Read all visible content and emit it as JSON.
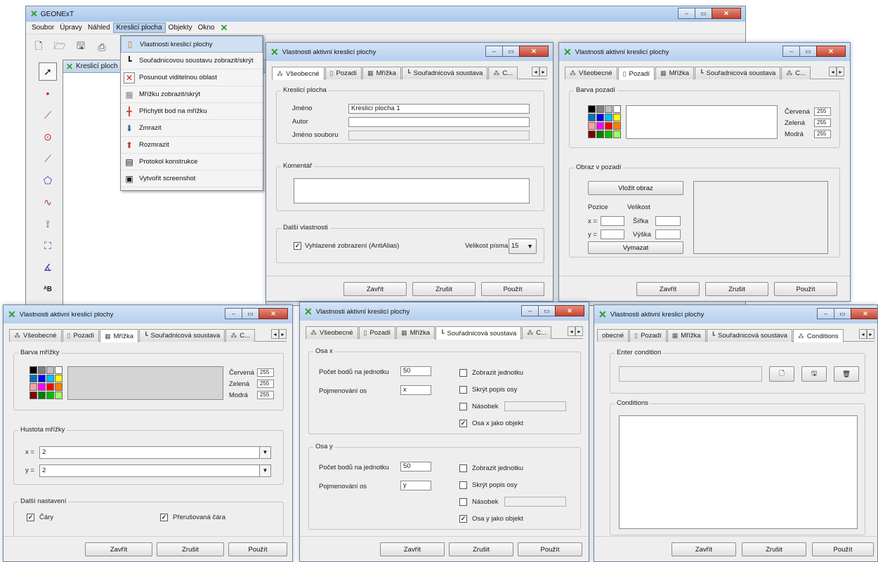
{
  "app": {
    "title": "GEONExT"
  },
  "menu": [
    "Soubor",
    "Úpravy",
    "Náhled",
    "Kreslicí plocha",
    "Objekty",
    "Okno"
  ],
  "canvas_tab": "Kreslicí ploch",
  "dropdown": [
    {
      "icon": "▯",
      "label": "Vlastnosti kreslicí plochy"
    },
    {
      "icon": "┗",
      "label": "Souřadnicovou soustavu zobrazit/skrýt"
    },
    {
      "icon": "✕",
      "label": "Posunout viditelnou oblast"
    },
    {
      "icon": "▦",
      "label": "Mřížku zobrazit/skrýt"
    },
    {
      "icon": "╋",
      "label": "Přichytit bod na mřížku"
    },
    {
      "icon": "⬇",
      "label": "Zmrazit"
    },
    {
      "icon": "⬆",
      "label": "Rozmrazit"
    },
    {
      "icon": "▤",
      "label": "Protokol konstrukce"
    },
    {
      "icon": "▣",
      "label": "Vytvořit screenshot"
    }
  ],
  "dialog_title": "Vlastnosti aktivní kreslicí plochy",
  "tabs": {
    "general": "Všeobecné",
    "background": "Pozadí",
    "grid": "Mřížka",
    "coords": "Souřadnicová soustava",
    "more": "C...",
    "general_cut": "obecné",
    "conditions": "Conditions"
  },
  "buttons": {
    "close": "Zavřít",
    "cancel": "Zrušit",
    "apply": "Použít"
  },
  "general": {
    "group_canvas": "Kreslicí plocha",
    "name_label": "Jméno",
    "name_value": "Kreslicí plocha 1",
    "author_label": "Autor",
    "author_value": "",
    "file_label": "Jméno souboru",
    "comment_group": "Komentář",
    "other_group": "Další vlastnosti",
    "antialias": "Vyhlazené zobrazení (AntiAlias)",
    "font_size_label": "Velikost písma",
    "font_size_value": "15"
  },
  "background": {
    "color_group": "Barva pozadí",
    "red_label": "Červená",
    "red_value": "255",
    "green_label": "Zelená",
    "green_value": "255",
    "blue_label": "Modrá",
    "blue_value": "255",
    "image_group": "Obraz v pozadí",
    "insert_button": "Vložit obraz",
    "position_label": "Pozice",
    "size_label": "Velikost",
    "x_label": "x =",
    "y_label": "y =",
    "width_label": "Šířka",
    "height_label": "Výška",
    "delete_button": "Vymazat"
  },
  "grid": {
    "color_group": "Barva mřížky",
    "red_label": "Červená",
    "red_value": "255",
    "green_label": "Zelená",
    "green_value": "255",
    "blue_label": "Modrá",
    "blue_value": "255",
    "density_group": "Hustota mřížky",
    "x_label": "x =",
    "x_value": "2",
    "y_label": "y =",
    "y_value": "2",
    "other_group": "Další nastavení",
    "lines": "Čáry",
    "dashed": "Přerušovaná čára"
  },
  "coords": {
    "x_group": "Osa x",
    "y_group": "Osa y",
    "points_label": "Počet bodů na jednotku",
    "points_x": "50",
    "points_y": "50",
    "naming_label": "Pojmenování os",
    "name_x": "x",
    "name_y": "y",
    "show_unit": "Zobrazit jednotku",
    "hide_label": "Skrýt popis osy",
    "multiple": "Násobek",
    "x_as_object": "Osa x jako objekt",
    "y_as_object": "Osa y jako objekt"
  },
  "conditions": {
    "enter_group": "Enter condition",
    "list_group": "Conditions"
  },
  "swatch_colors": [
    "#000000",
    "#808080",
    "#c0c0c0",
    "#ffffff",
    "#0070c0",
    "#0000ff",
    "#00c0ff",
    "#ffff00",
    "#ffa0a0",
    "#ff00ff",
    "#ff0000",
    "#ff8000",
    "#800000",
    "#008000",
    "#00c000",
    "#a0ff60"
  ],
  "colors": {
    "titlebar": "#b5cfee",
    "dialog_bg": "#eeeeee",
    "accent_green": "#2d9a2d"
  }
}
